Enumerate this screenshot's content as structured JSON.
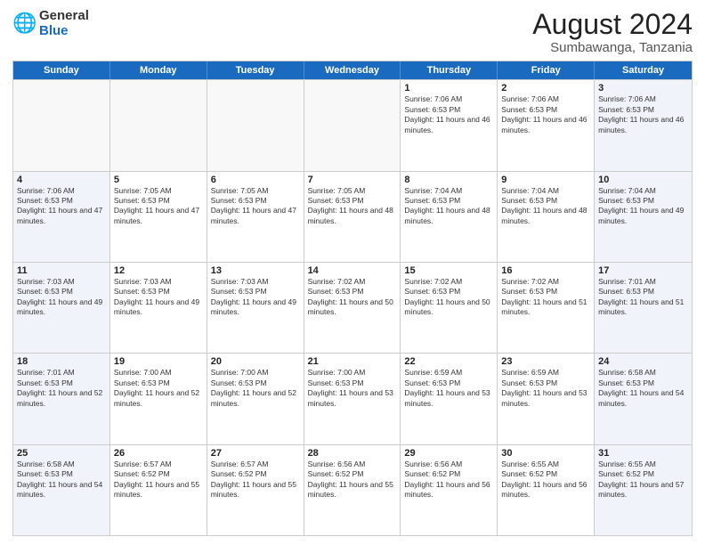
{
  "logo": {
    "general": "General",
    "blue": "Blue"
  },
  "title": {
    "month": "August 2024",
    "location": "Sumbawanga, Tanzania"
  },
  "header_days": [
    "Sunday",
    "Monday",
    "Tuesday",
    "Wednesday",
    "Thursday",
    "Friday",
    "Saturday"
  ],
  "weeks": [
    [
      {
        "day": "",
        "empty": true
      },
      {
        "day": "",
        "empty": true
      },
      {
        "day": "",
        "empty": true
      },
      {
        "day": "",
        "empty": true
      },
      {
        "day": "1",
        "sunrise": "7:06 AM",
        "sunset": "6:53 PM",
        "daylight": "11 hours and 46 minutes."
      },
      {
        "day": "2",
        "sunrise": "7:06 AM",
        "sunset": "6:53 PM",
        "daylight": "11 hours and 46 minutes."
      },
      {
        "day": "3",
        "sunrise": "7:06 AM",
        "sunset": "6:53 PM",
        "daylight": "11 hours and 46 minutes."
      }
    ],
    [
      {
        "day": "4",
        "sunrise": "7:06 AM",
        "sunset": "6:53 PM",
        "daylight": "11 hours and 47 minutes."
      },
      {
        "day": "5",
        "sunrise": "7:05 AM",
        "sunset": "6:53 PM",
        "daylight": "11 hours and 47 minutes."
      },
      {
        "day": "6",
        "sunrise": "7:05 AM",
        "sunset": "6:53 PM",
        "daylight": "11 hours and 47 minutes."
      },
      {
        "day": "7",
        "sunrise": "7:05 AM",
        "sunset": "6:53 PM",
        "daylight": "11 hours and 48 minutes."
      },
      {
        "day": "8",
        "sunrise": "7:04 AM",
        "sunset": "6:53 PM",
        "daylight": "11 hours and 48 minutes."
      },
      {
        "day": "9",
        "sunrise": "7:04 AM",
        "sunset": "6:53 PM",
        "daylight": "11 hours and 48 minutes."
      },
      {
        "day": "10",
        "sunrise": "7:04 AM",
        "sunset": "6:53 PM",
        "daylight": "11 hours and 49 minutes."
      }
    ],
    [
      {
        "day": "11",
        "sunrise": "7:03 AM",
        "sunset": "6:53 PM",
        "daylight": "11 hours and 49 minutes."
      },
      {
        "day": "12",
        "sunrise": "7:03 AM",
        "sunset": "6:53 PM",
        "daylight": "11 hours and 49 minutes."
      },
      {
        "day": "13",
        "sunrise": "7:03 AM",
        "sunset": "6:53 PM",
        "daylight": "11 hours and 49 minutes."
      },
      {
        "day": "14",
        "sunrise": "7:02 AM",
        "sunset": "6:53 PM",
        "daylight": "11 hours and 50 minutes."
      },
      {
        "day": "15",
        "sunrise": "7:02 AM",
        "sunset": "6:53 PM",
        "daylight": "11 hours and 50 minutes."
      },
      {
        "day": "16",
        "sunrise": "7:02 AM",
        "sunset": "6:53 PM",
        "daylight": "11 hours and 51 minutes."
      },
      {
        "day": "17",
        "sunrise": "7:01 AM",
        "sunset": "6:53 PM",
        "daylight": "11 hours and 51 minutes."
      }
    ],
    [
      {
        "day": "18",
        "sunrise": "7:01 AM",
        "sunset": "6:53 PM",
        "daylight": "11 hours and 52 minutes."
      },
      {
        "day": "19",
        "sunrise": "7:00 AM",
        "sunset": "6:53 PM",
        "daylight": "11 hours and 52 minutes."
      },
      {
        "day": "20",
        "sunrise": "7:00 AM",
        "sunset": "6:53 PM",
        "daylight": "11 hours and 52 minutes."
      },
      {
        "day": "21",
        "sunrise": "7:00 AM",
        "sunset": "6:53 PM",
        "daylight": "11 hours and 53 minutes."
      },
      {
        "day": "22",
        "sunrise": "6:59 AM",
        "sunset": "6:53 PM",
        "daylight": "11 hours and 53 minutes."
      },
      {
        "day": "23",
        "sunrise": "6:59 AM",
        "sunset": "6:53 PM",
        "daylight": "11 hours and 53 minutes."
      },
      {
        "day": "24",
        "sunrise": "6:58 AM",
        "sunset": "6:53 PM",
        "daylight": "11 hours and 54 minutes."
      }
    ],
    [
      {
        "day": "25",
        "sunrise": "6:58 AM",
        "sunset": "6:53 PM",
        "daylight": "11 hours and 54 minutes."
      },
      {
        "day": "26",
        "sunrise": "6:57 AM",
        "sunset": "6:52 PM",
        "daylight": "11 hours and 55 minutes."
      },
      {
        "day": "27",
        "sunrise": "6:57 AM",
        "sunset": "6:52 PM",
        "daylight": "11 hours and 55 minutes."
      },
      {
        "day": "28",
        "sunrise": "6:56 AM",
        "sunset": "6:52 PM",
        "daylight": "11 hours and 55 minutes."
      },
      {
        "day": "29",
        "sunrise": "6:56 AM",
        "sunset": "6:52 PM",
        "daylight": "11 hours and 56 minutes."
      },
      {
        "day": "30",
        "sunrise": "6:55 AM",
        "sunset": "6:52 PM",
        "daylight": "11 hours and 56 minutes."
      },
      {
        "day": "31",
        "sunrise": "6:55 AM",
        "sunset": "6:52 PM",
        "daylight": "11 hours and 57 minutes."
      }
    ]
  ]
}
